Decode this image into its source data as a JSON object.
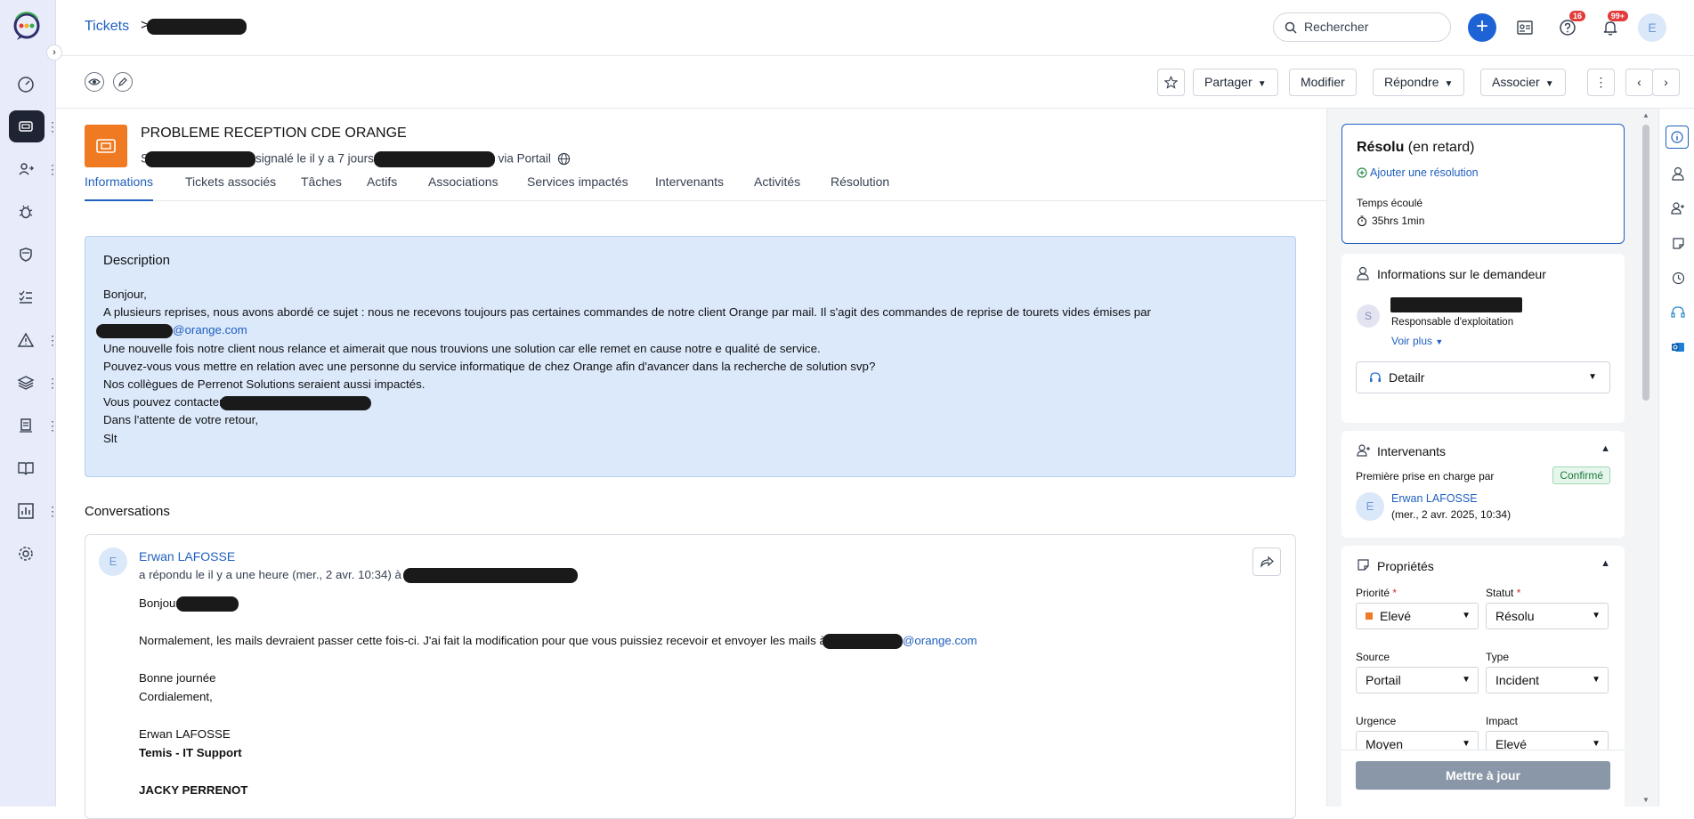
{
  "topbar": {
    "breadcrumb_root": "Tickets",
    "breadcrumb_sep": ">",
    "search_placeholder": "Rechercher",
    "plus_label": "+",
    "help_badge": "16",
    "notif_badge": "99+",
    "avatar_initial": "E"
  },
  "sidebar": {
    "items": [
      "dashboard-icon",
      "tickets-icon",
      "changes-icon",
      "bug-icon",
      "shield-icon",
      "tasks-icon",
      "alert-icon",
      "layers-icon",
      "assets-icon",
      "book-icon",
      "reports-icon",
      "settings-icon"
    ],
    "dots": "⋮"
  },
  "actionbar": {
    "share": "Partager",
    "modify": "Modifier",
    "reply": "Répondre",
    "associate": "Associer"
  },
  "ticket": {
    "title": "PROBLEME RECEPTION CDE ORANGE",
    "sub_prefix": "S",
    "sub_reported": "signalé le il y a 7 jours",
    "sub_via": "via Portail",
    "tabs": [
      "Informations",
      "Tickets associés",
      "Tâches",
      "Actifs",
      "Associations",
      "Services impactés",
      "Intervenants",
      "Activités",
      "Résolution"
    ]
  },
  "description": {
    "title": "Description",
    "line1": "Bonjour,",
    "line2": "A plusieurs reprises, nous avons abordé ce sujet : nous ne recevons toujours pas certaines commandes de notre client Orange par mail. Il s'agit des commandes de reprise de tourets vides émises par",
    "line3_link": "@orange.com",
    "line4": "Une nouvelle fois notre client nous relance et aimerait que nous trouvions une solution car elle remet en cause notre e qualité de service.",
    "line5": "Pouvez-vous vous mettre en relation avec une personne du service informatique de chez Orange afin d'avancer dans la recherche de solution svp?",
    "line6": "Nos collègues de Perrenot Solutions seraient aussi impactés.",
    "line7": "Vous pouvez contacter",
    "line8": "Dans l'attente de votre retour,",
    "line9": "Slt"
  },
  "conversations": {
    "title": "Conversations",
    "author": "Erwan LAFOSSE",
    "avatar": "E",
    "meta": "a répondu le il y a une heure (mer., 2 avr. 10:34) à s",
    "greeting": "Bonjour",
    "body1": "Normalement, les mails devraient passer cette fois-ci. J'ai fait la modification pour que vous puissiez recevoir et envoyer les mails à",
    "body1_link": "@orange.com",
    "body2": "Bonne journée",
    "body3": "Cordialement,",
    "sig_name": "Erwan LAFOSSE",
    "sig_team": "Temis - IT Support",
    "sig_company": "JACKY PERRENOT"
  },
  "status_card": {
    "status": "Résolu",
    "late": "(en retard)",
    "add_resolution": "Ajouter une résolution",
    "elapsed_label": "Temps écoulé",
    "elapsed_value": "35hrs 1min"
  },
  "requester": {
    "title": "Informations sur le demandeur",
    "avatar": "S",
    "role": "Responsable d'exploitation",
    "more": "Voir plus",
    "dropdown": "Detailr"
  },
  "intervenants": {
    "title": "Intervenants",
    "first_label": "Première prise en charge par",
    "confirmed": "Confirmé",
    "avatar": "E",
    "name": "Erwan LAFOSSE",
    "date": "(mer., 2 avr. 2025, 10:34)"
  },
  "properties": {
    "title": "Propriétés",
    "priority_label": "Priorité",
    "priority_value": "Elevé",
    "status_label": "Statut",
    "status_value": "Résolu",
    "source_label": "Source",
    "source_value": "Portail",
    "type_label": "Type",
    "type_value": "Incident",
    "urgency_label": "Urgence",
    "urgency_value": "Moyen",
    "impact_label": "Impact",
    "impact_value": "Elevé",
    "required_mark": "*",
    "update_button": "Mettre à jour"
  }
}
